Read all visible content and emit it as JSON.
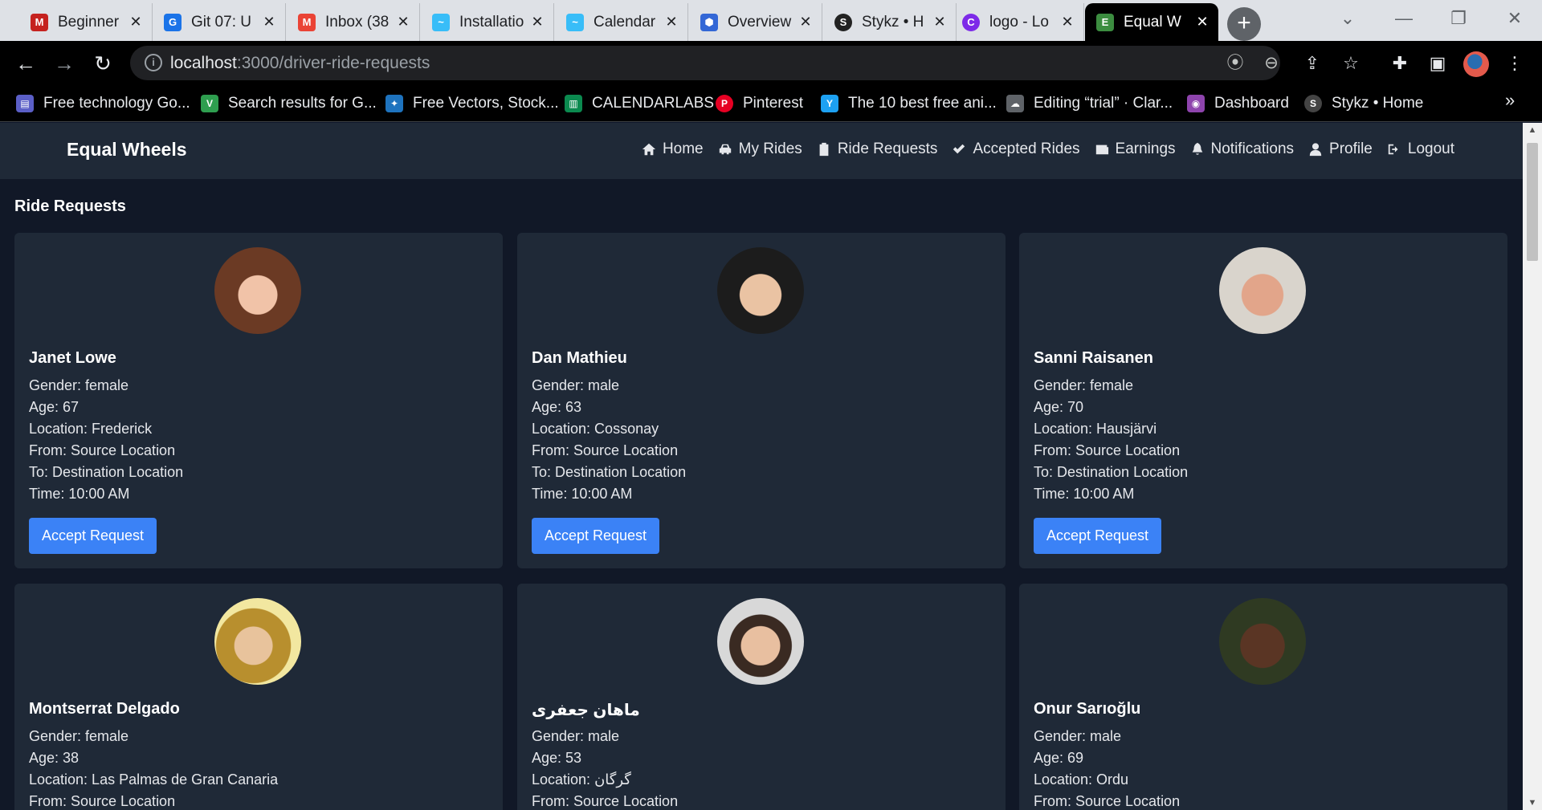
{
  "tabs": [
    {
      "title": "Beginner",
      "icon": "gmail-like-icon",
      "color": "#c5221f"
    },
    {
      "title": "Git 07: U",
      "icon": "git-icon",
      "color": "#1a73e8"
    },
    {
      "title": "Inbox (38",
      "icon": "mail-icon",
      "color": "#ea4335"
    },
    {
      "title": "Installatio",
      "icon": "tailwind-icon",
      "color": "#38bdf8"
    },
    {
      "title": "Calendar",
      "icon": "tailwind-icon",
      "color": "#38bdf8"
    },
    {
      "title": "Overview",
      "icon": "hexagon-icon",
      "color": "#3367d6"
    },
    {
      "title": "Stykz • H",
      "icon": "stykz-icon",
      "color": "#222222"
    },
    {
      "title": "logo - Lo",
      "icon": "canva-icon",
      "color": "#7d2ae8"
    },
    {
      "title": "Equal W",
      "icon": "app-icon",
      "color": "#3c8d40"
    }
  ],
  "address": {
    "host": "localhost",
    "path": ":3000/driver-ride-requests"
  },
  "bookmarks": [
    {
      "label": "Free technology Go...",
      "color": "#5b5fc7"
    },
    {
      "label": "Search results for G...",
      "color": "#2e9e4f"
    },
    {
      "label": "Free Vectors, Stock...",
      "color": "#1e73be"
    },
    {
      "label": "CALENDARLABS",
      "color": "#0b8a4f"
    },
    {
      "label": "Pinterest",
      "color": "#e60023"
    },
    {
      "label": "The 10 best free ani...",
      "color": "#1da1f2"
    },
    {
      "label": "Editing “trial” · Clar...",
      "color": "#5f6368"
    },
    {
      "label": "Dashboard",
      "color": "#8e44ad"
    },
    {
      "label": "Stykz • Home",
      "color": "#444444"
    }
  ],
  "app": {
    "brand": "Equal Wheels",
    "nav": [
      {
        "label": "Home",
        "icon": "home-icon"
      },
      {
        "label": "My Rides",
        "icon": "car-icon"
      },
      {
        "label": "Ride Requests",
        "icon": "clipboard-icon"
      },
      {
        "label": "Accepted Rides",
        "icon": "check-icon"
      },
      {
        "label": "Earnings",
        "icon": "wallet-icon"
      },
      {
        "label": "Notifications",
        "icon": "bell-icon"
      },
      {
        "label": "Profile",
        "icon": "user-icon"
      },
      {
        "label": "Logout",
        "icon": "logout-icon"
      }
    ],
    "page_title": "Ride Requests",
    "accept_label": "Accept Request",
    "requests": [
      {
        "name": "Janet Lowe",
        "gender": "Gender: female",
        "age": "Age: 67",
        "location": "Location: Frederick",
        "from": "From: Source Location",
        "to": "To: Destination Location",
        "time": "Time: 10:00 AM"
      },
      {
        "name": "Dan Mathieu",
        "gender": "Gender: male",
        "age": "Age: 63",
        "location": "Location: Cossonay",
        "from": "From: Source Location",
        "to": "To: Destination Location",
        "time": "Time: 10:00 AM"
      },
      {
        "name": "Sanni Raisanen",
        "gender": "Gender: female",
        "age": "Age: 70",
        "location": "Location: Hausjärvi",
        "from": "From: Source Location",
        "to": "To: Destination Location",
        "time": "Time: 10:00 AM"
      },
      {
        "name": "Montserrat Delgado",
        "gender": "Gender: female",
        "age": "Age: 38",
        "location": "Location: Las Palmas de Gran Canaria",
        "from": "From: Source Location",
        "to": "",
        "time": ""
      },
      {
        "name": "ماهان جعفری",
        "gender": "Gender: male",
        "age": "Age: 53",
        "location": "Location: گرگان",
        "from": "From: Source Location",
        "to": "",
        "time": ""
      },
      {
        "name": "Onur Sarıoğlu",
        "gender": "Gender: male",
        "age": "Age: 69",
        "location": "Location: Ordu",
        "from": "From: Source Location",
        "to": "",
        "time": ""
      }
    ]
  }
}
